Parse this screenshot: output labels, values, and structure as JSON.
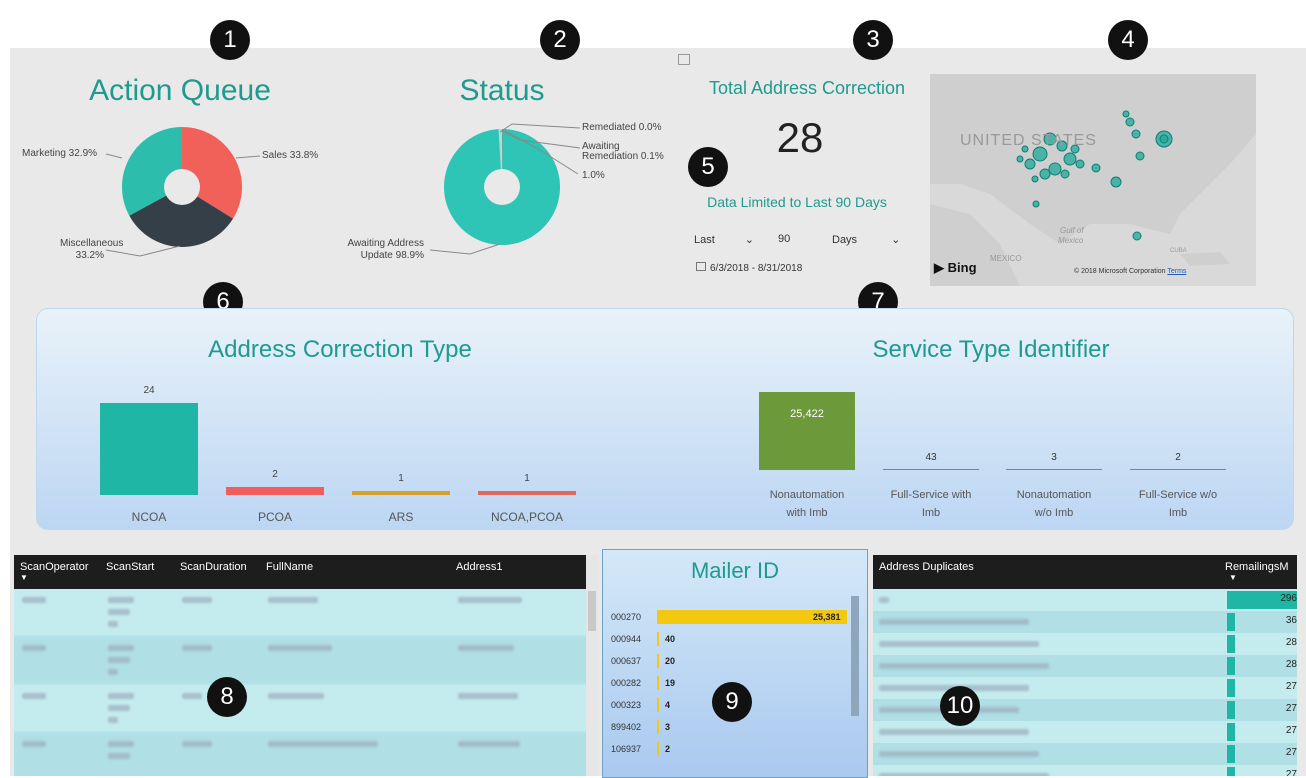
{
  "badges": [
    "1",
    "2",
    "3",
    "4",
    "5",
    "6",
    "7",
    "8",
    "9",
    "10"
  ],
  "action_queue": {
    "title": "Action Queue",
    "slices": [
      {
        "label": "Sales 33.8%",
        "value": 33.8,
        "color": "#f2605a"
      },
      {
        "label": "Miscellaneous",
        "label2": "33.2%",
        "value": 33.2,
        "color": "#353f47"
      },
      {
        "label": "Marketing 32.9%",
        "value": 32.9,
        "color": "#2dbdad"
      }
    ]
  },
  "status": {
    "title": "Status",
    "labels": {
      "remediated": "Remediated 0.0%",
      "awaiting_rem_1": "Awaiting",
      "awaiting_rem_2": "Remediation 0.1%",
      "other": "1.0%",
      "awaiting_addr_1": "Awaiting Address",
      "awaiting_addr_2": "Update 98.9%"
    },
    "slices": [
      {
        "name": "Awaiting Address Update",
        "value": 98.9,
        "color": "#2ec4b6"
      },
      {
        "name": "other",
        "value": 1.0,
        "color": "#a9ddd6"
      },
      {
        "name": "Awaiting Remediation",
        "value": 0.1,
        "color": "#555555"
      },
      {
        "name": "Remediated",
        "value": 0.0,
        "color": "#999999"
      }
    ]
  },
  "total": {
    "title": "Total Address Correction",
    "value": "28",
    "limit_text": "Data Limited to Last 90 Days",
    "filter_last": "Last",
    "filter_num": "90",
    "filter_unit": "Days",
    "date_range": "6/3/2018 - 8/31/2018"
  },
  "map": {
    "country_label": "UNITED STATES",
    "mexico_label": "MEXICO",
    "gulf_label_1": "Gulf of",
    "gulf_label_2": "Mexico",
    "cuba_label": "CUBA",
    "bing_label": "Bing",
    "copyright": "© 2018 Microsoft Corporation",
    "terms": "Terms"
  },
  "address_correction_type": {
    "title": "Address Correction Type",
    "bars": [
      {
        "label": "NCOA",
        "value": 24,
        "color": "#1fb6a5"
      },
      {
        "label": "PCOA",
        "value": 2,
        "color": "#f25c5c"
      },
      {
        "label": "ARS",
        "value": 1,
        "color": "#d6a129"
      },
      {
        "label": "NCOA,PCOA",
        "value": 1,
        "color": "#e0675c"
      }
    ]
  },
  "service_type": {
    "title": "Service Type Identifier",
    "items": [
      {
        "label1": "Nonautomation",
        "label2": "with Imb",
        "value": "25,422"
      },
      {
        "label1": "Full-Service with",
        "label2": "Imb",
        "value": "43"
      },
      {
        "label1": "Nonautomation",
        "label2": "w/o Imb",
        "value": "3"
      },
      {
        "label1": "Full-Service w/o",
        "label2": "Imb",
        "value": "2"
      }
    ]
  },
  "scan_table": {
    "columns": [
      "ScanOperator",
      "ScanStart",
      "ScanDuration",
      "FullName",
      "Address1"
    ]
  },
  "mailer": {
    "title": "Mailer ID",
    "rows": [
      {
        "id": "000270",
        "value": 25381,
        "label": "25,381"
      },
      {
        "id": "000944",
        "value": 40,
        "label": "40"
      },
      {
        "id": "000637",
        "value": 20,
        "label": "20"
      },
      {
        "id": "000282",
        "value": 19,
        "label": "19"
      },
      {
        "id": "000323",
        "value": 4,
        "label": "4"
      },
      {
        "id": "899402",
        "value": 3,
        "label": "3"
      },
      {
        "id": "106937",
        "value": 2,
        "label": "2"
      }
    ]
  },
  "duplicates": {
    "col1": "Address Duplicates",
    "col2": "RemailingsM",
    "values": [
      "296",
      "36",
      "28",
      "28",
      "27",
      "27",
      "27",
      "27",
      "27"
    ]
  }
}
